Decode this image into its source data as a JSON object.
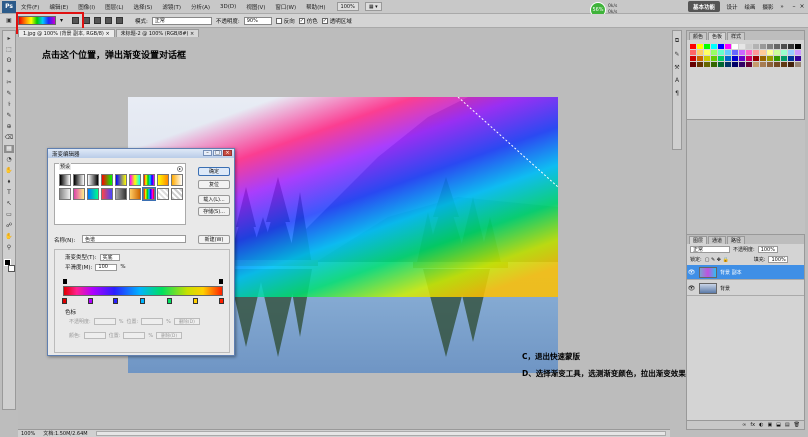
{
  "menubar": {
    "logo": "Ps",
    "items": [
      "文件(F)",
      "编辑(E)",
      "图像(I)",
      "图层(L)",
      "选择(S)",
      "滤镜(T)",
      "分析(A)",
      "3D(D)",
      "视图(V)",
      "窗口(W)",
      "帮助(H)"
    ],
    "zoom": "100%",
    "workspace": [
      "基本功能",
      "设计",
      "绘画",
      "摄影",
      "»"
    ],
    "window_controls": [
      "–",
      "□",
      "×"
    ],
    "net_widget": {
      "percent": "56%",
      "line1": "0k/s",
      "line2": "0k/s"
    }
  },
  "options": {
    "mode_label": "模式:",
    "mode_value": "正常",
    "opacity_label": "不透明度:",
    "opacity_value": "90%",
    "reverse_label": "反向",
    "dither_label": "仿色",
    "transparency_label": "透明区域"
  },
  "tabs": [
    "1.jpg @ 100% (背景 副本, RGB/8) ×",
    "未标题-2 @ 100% (RGB/8#) ×"
  ],
  "toolbox": {
    "tools": [
      "▸",
      "⬚",
      "ʘ",
      "⌗",
      "✂",
      "✎",
      "⚕",
      "✎",
      "⊕",
      "⌫",
      "▦",
      "◔",
      "✋",
      "⬧",
      "T",
      "↖",
      "▭",
      "☍",
      "✋",
      "⚲"
    ]
  },
  "canvas": {
    "instruction_top": "点击这个位置，弹出渐变设置对话框",
    "instruction_c": "C，退出快速蒙版",
    "instruction_d": "D、选择渐变工具，选测渐变颜色，拉出渐变效果。"
  },
  "dialog": {
    "title": "渐变编辑器",
    "controls": [
      "–",
      "□",
      "×"
    ],
    "presets_label": "预设",
    "buttons": {
      "ok": "确定",
      "reset": "复位",
      "load": "载入(L)...",
      "save": "存储(S)...",
      "new": "新建(W)"
    },
    "name_label": "名称(N):",
    "name_value": "色谱",
    "type_label": "渐变类型(T):",
    "type_value": "实底",
    "smooth_label": "平滑度(M):",
    "smooth_value": "100",
    "smooth_unit": "%",
    "stops_label": "色标",
    "opacity_label": "不透明度:",
    "opacity_unit": "%",
    "location_label": "位置:",
    "location_unit": "%",
    "delete_label": "删除(D)",
    "color_label": "颜色:"
  },
  "right_panel": {
    "colors_tabs": [
      "颜色",
      "色板",
      "样式"
    ],
    "layers_tabs": [
      "图层",
      "通道",
      "路径"
    ],
    "blend_mode": "正常",
    "opacity_label": "不透明度:",
    "opacity_value": "100%",
    "lock_label": "锁定:",
    "fill_label": "填充:",
    "fill_value": "100%",
    "layers": [
      "背景 副本",
      "背景"
    ],
    "footer_icons": [
      "∞",
      "fx",
      "◐",
      "▣",
      "⬓",
      "▤",
      "🗑"
    ]
  },
  "statusbar": {
    "zoom": "100%",
    "doc_info": "文档:1.50M/2.64M"
  }
}
